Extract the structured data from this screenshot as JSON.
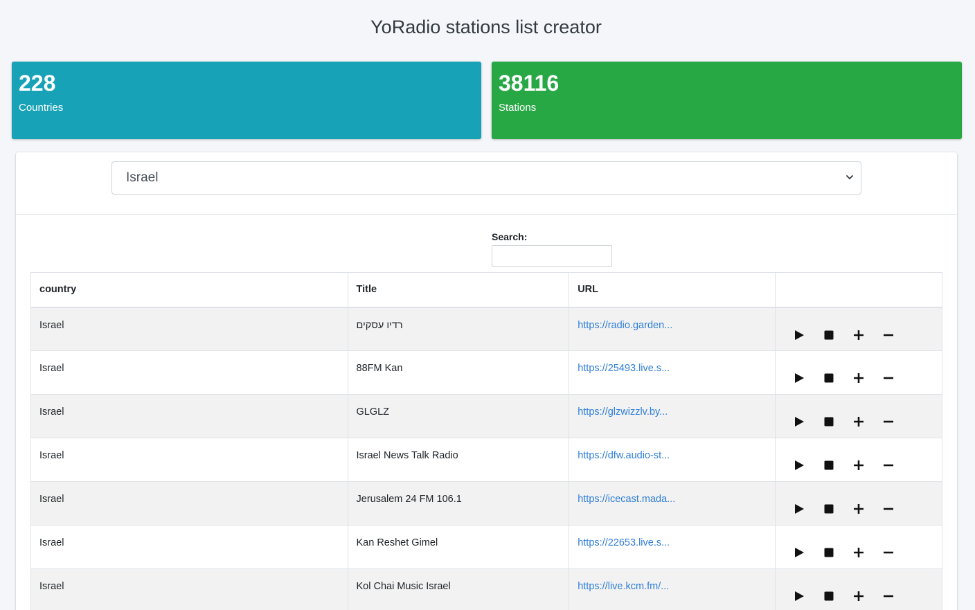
{
  "header": {
    "title": "YoRadio stations list creator"
  },
  "stats": {
    "countries": {
      "value": "228",
      "label": "Countries",
      "color": "#17a2b8"
    },
    "stations": {
      "value": "38116",
      "label": "Stations",
      "color": "#28a745"
    }
  },
  "filter": {
    "selected_country": "Israel",
    "icon": "chevron-down-icon"
  },
  "search": {
    "label": "Search:",
    "value": ""
  },
  "table": {
    "columns": [
      "country",
      "Title",
      "URL",
      ""
    ],
    "rows": [
      {
        "country": "Israel",
        "title": "רדיו עסקים",
        "url": "https://radio.garden..."
      },
      {
        "country": "Israel",
        "title": "88FM Kan",
        "url": "https://25493.live.s..."
      },
      {
        "country": "Israel",
        "title": "GLGLZ",
        "url": "https://glzwizzlv.by..."
      },
      {
        "country": "Israel",
        "title": "Israel News Talk Radio",
        "url": "https://dfw.audio-st..."
      },
      {
        "country": "Israel",
        "title": "Jerusalem 24 FM 106.1",
        "url": "https://icecast.mada..."
      },
      {
        "country": "Israel",
        "title": "Kan Reshet Gimel",
        "url": "https://22653.live.s..."
      },
      {
        "country": "Israel",
        "title": "Kol Chai Music Israel",
        "url": "https://live.kcm.fm/..."
      }
    ],
    "row_actions": [
      "play-icon",
      "stop-icon",
      "plus-icon",
      "minus-icon"
    ]
  },
  "colors": {
    "link": "#2f7ed8",
    "stripe": "#f2f2f2",
    "background": "#f4f6f9"
  }
}
